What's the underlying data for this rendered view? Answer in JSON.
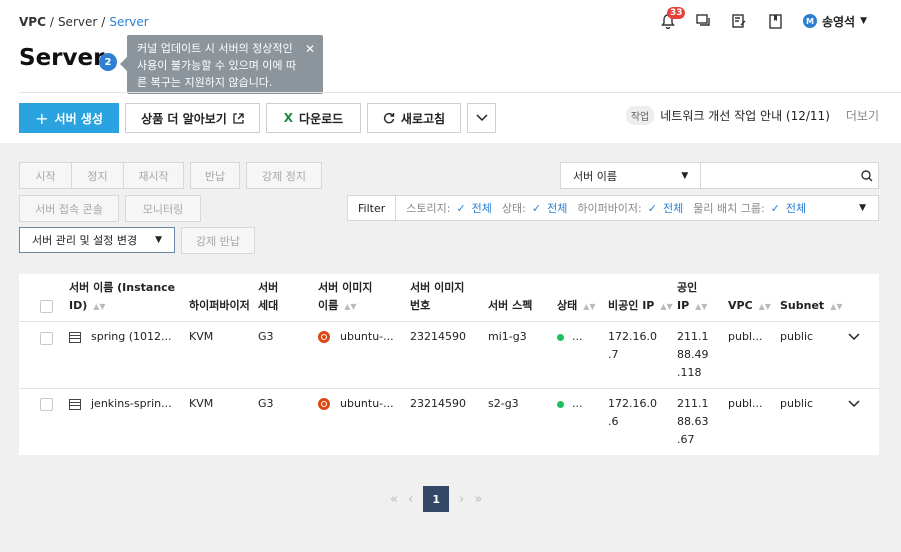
{
  "breadcrumb": {
    "root": "VPC",
    "sep1": "/",
    "mid": "Server",
    "sep2": "/",
    "current": "Server"
  },
  "header": {
    "notification_count": "33",
    "user_initial": "M",
    "user_name": "송영석"
  },
  "page": {
    "title": "Server",
    "count": "2"
  },
  "tooltip": {
    "text": "커널 업데이트 시 서버의 정상적인 사용이 불가능할 수 있으며 이에 따른 복구는 지원하지 않습니다."
  },
  "toolbar": {
    "create": "서버 생성",
    "learn_more": "상품 더 알아보기",
    "download": "다운로드",
    "refresh": "새로고침"
  },
  "notice": {
    "tag": "작업",
    "text": "네트워크 개선 작업 안내 (12/11)",
    "more": "더보기"
  },
  "actions": {
    "start": "시작",
    "stop": "정지",
    "restart": "재시작",
    "return": "반납",
    "force_stop": "강제 정지",
    "console": "서버 접속 콘솔",
    "monitoring": "모니터링",
    "manage": "서버 관리 및 설정 변경",
    "force_return": "강제 반납"
  },
  "search": {
    "field": "서버 이름",
    "placeholder": ""
  },
  "filter": {
    "label": "Filter",
    "items": [
      {
        "name": "스토리지:",
        "value": "전체"
      },
      {
        "name": "상태:",
        "value": "전체"
      },
      {
        "name": "하이퍼바이저:",
        "value": "전체"
      },
      {
        "name": "물리 배치 그룹:",
        "value": "전체"
      }
    ]
  },
  "table": {
    "headers": {
      "name_l1": "서버 이름 (Instance",
      "name_l2": "ID)",
      "hypervisor": "하이퍼바이저",
      "gen_l1": "서버",
      "gen_l2": "세대",
      "image_name_l1": "서버 이미지",
      "image_name_l2": "이름",
      "image_no_l1": "서버 이미지",
      "image_no_l2": "번호",
      "spec": "서버 스펙",
      "status": "상태",
      "private_ip": "비공인 IP",
      "public_ip_l1": "공인",
      "public_ip_l2": "IP",
      "vpc": "VPC",
      "subnet": "Subnet"
    },
    "rows": [
      {
        "name": "spring (1012...",
        "hypervisor": "KVM",
        "gen": "G3",
        "image": "ubuntu-...",
        "image_no": "23214590",
        "spec": "mi1-g3",
        "status": "...",
        "private_ip_1": "172.16.0",
        "private_ip_2": ".7",
        "public_ip_1": "211.1",
        "public_ip_2": "88.49",
        "public_ip_3": ".118",
        "vpc": "publ...",
        "subnet": "public"
      },
      {
        "name": "jenkins-sprin...",
        "hypervisor": "KVM",
        "gen": "G3",
        "image": "ubuntu-...",
        "image_no": "23214590",
        "spec": "s2-g3",
        "status": "...",
        "private_ip_1": "172.16.0",
        "private_ip_2": ".6",
        "public_ip_1": "211.1",
        "public_ip_2": "88.63",
        "public_ip_3": ".67",
        "vpc": "publ...",
        "subnet": "public"
      }
    ]
  },
  "pagination": {
    "current": "1"
  },
  "colors": {
    "primary": "#2aa3e0",
    "link": "#2d7fd3",
    "status_running": "#1ec15f",
    "page_active": "#334866"
  }
}
